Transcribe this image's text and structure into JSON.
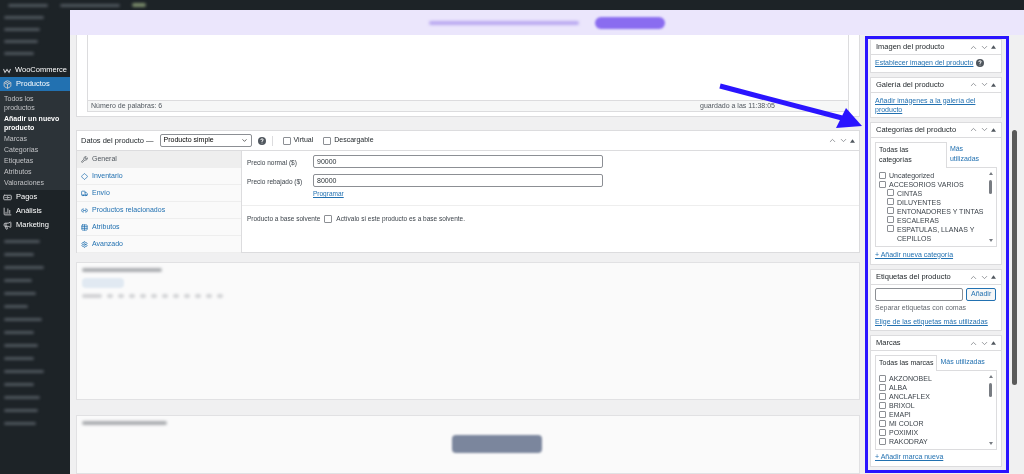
{
  "sidebar": {
    "items": [
      {
        "label": "WooCommerce",
        "kind": "woo",
        "selected": false
      },
      {
        "label": "Productos",
        "kind": "box",
        "selected": true
      },
      {
        "label": "Pagos",
        "kind": "card",
        "selected": false
      },
      {
        "label": "Análisis",
        "kind": "chart",
        "selected": false
      },
      {
        "label": "Marketing",
        "kind": "megaphone",
        "selected": false
      }
    ],
    "submenu": [
      {
        "label": "Todos los productos",
        "selected": false
      },
      {
        "label": "Añadir un nuevo producto",
        "selected": true
      },
      {
        "label": "Marcas",
        "selected": false
      },
      {
        "label": "Categorías",
        "selected": false
      },
      {
        "label": "Etiquetas",
        "selected": false
      },
      {
        "label": "Atributos",
        "selected": false
      },
      {
        "label": "Valoraciones",
        "selected": false
      }
    ]
  },
  "editor": {
    "word_count": "Número de palabras: 6",
    "saved": "guardado a las 11:38:05"
  },
  "product_data": {
    "title": "Datos del producto —",
    "type": "Producto simple",
    "options": [
      {
        "label": "Virtual",
        "checked": false
      },
      {
        "label": "Descargable",
        "checked": false
      }
    ],
    "tabs": [
      {
        "label": "General",
        "kind": "wrench",
        "selected": true
      },
      {
        "label": "Inventario",
        "kind": "diamond",
        "selected": false
      },
      {
        "label": "Envío",
        "kind": "truck",
        "selected": false
      },
      {
        "label": "Productos relacionados",
        "kind": "link",
        "selected": false
      },
      {
        "label": "Atributos",
        "kind": "table",
        "selected": false
      },
      {
        "label": "Avanzado",
        "kind": "gear",
        "selected": false
      }
    ],
    "fields": [
      {
        "label": "Precio normal ($)",
        "value": "90000"
      },
      {
        "label": "Precio rebajado ($)",
        "value": "80000"
      }
    ],
    "schedule_link": "Programar",
    "solvent": {
      "label": "Producto a base solvente",
      "text": "Actívalo si este producto es a base solvente.",
      "checked": false
    }
  },
  "side_boxes": {
    "image": {
      "title": "Imagen del producto",
      "link": "Establecer imagen del producto"
    },
    "gallery": {
      "title": "Galería del producto",
      "link": "Añadir imágenes a la galería del producto"
    },
    "categories": {
      "title": "Categorías del producto",
      "tabs": [
        {
          "label": "Todas las categorías",
          "selected": true
        },
        {
          "label": "Más utilizadas",
          "selected": false
        }
      ],
      "items": [
        {
          "label": "Uncategorized",
          "checked": false
        },
        {
          "label": "ACCESORIOS VARIOS",
          "checked": false,
          "children": [
            {
              "label": "CINTAS",
              "checked": false
            },
            {
              "label": "DILUYENTES",
              "checked": false
            },
            {
              "label": "ENTONADORES Y TINTAS",
              "checked": false
            },
            {
              "label": "ESCALERAS",
              "checked": false
            },
            {
              "label": "ESPATULAS, LLANAS Y CEPILLOS",
              "checked": false
            }
          ]
        }
      ],
      "add_link": "+ Añadir nueva categoría"
    },
    "tags": {
      "title": "Etiquetas del producto",
      "button": "Añadir",
      "hint": "Separar etiquetas con comas",
      "link": "Elige de las etiquetas más utilizadas"
    },
    "brands": {
      "title": "Marcas",
      "tabs": [
        {
          "label": "Todas las marcas",
          "selected": true
        },
        {
          "label": "Más utilizadas",
          "selected": false
        }
      ],
      "items": [
        {
          "label": "AKZONOBEL",
          "checked": false
        },
        {
          "label": "ALBA",
          "checked": false
        },
        {
          "label": "ANCLAFLEX",
          "checked": false
        },
        {
          "label": "BRIXOL",
          "checked": false
        },
        {
          "label": "EMAPI",
          "checked": false
        },
        {
          "label": "MI COLOR",
          "checked": false
        },
        {
          "label": "POXIMIX",
          "checked": false
        },
        {
          "label": "RAKODRAY",
          "checked": false
        }
      ],
      "add_link": "+ Añadir marca nueva"
    }
  }
}
